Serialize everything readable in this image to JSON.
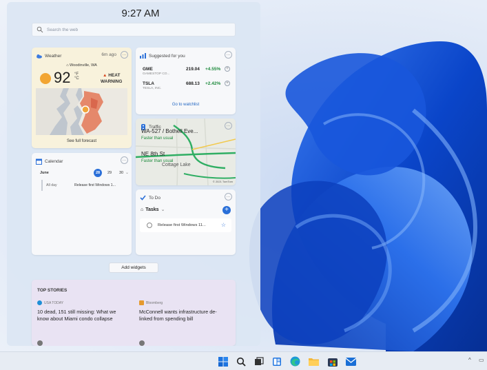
{
  "clock": "9:27 AM",
  "search": {
    "placeholder": "Search the web"
  },
  "weather": {
    "title": "Weather",
    "time": "6m ago",
    "location": "Woodinville, WA",
    "temp": "92",
    "unit_f": "°F",
    "unit_c": "°C",
    "warning_line1": "HEAT",
    "warning_line2": "WARNING",
    "link": "See full forecast"
  },
  "stocks": {
    "title": "Suggested for you",
    "items": [
      {
        "symbol": "GME",
        "name": "GAMESTOP CO...",
        "price": "219.04",
        "change": "+4.55%"
      },
      {
        "symbol": "TSLA",
        "name": "TESLA, INC.",
        "price": "688.13",
        "change": "+2.42%"
      }
    ],
    "link": "Go to watchlist"
  },
  "traffic": {
    "title": "Traffic",
    "route1": "WA-527 / Bothell Eve...",
    "route1_status": "Faster than usual",
    "route2": "NE 8th St",
    "route2_status": "Faster than usual",
    "place": "Cottage Lake",
    "copyright": "© 2021 TomTom"
  },
  "calendar": {
    "title": "Calendar",
    "month": "June",
    "days": [
      "28",
      "29",
      "30"
    ],
    "event_time": "All day",
    "event_title": "Release first Windows 1..."
  },
  "todo": {
    "title": "To Do",
    "list": "Tasks",
    "item": "Release first Windows 11..."
  },
  "add_widgets": "Add widgets",
  "stories": {
    "header": "TOP STORIES",
    "items": [
      {
        "source": "USA TODAY",
        "headline": "10 dead, 151 still missing: What we know about Miami condo collapse"
      },
      {
        "source": "Bloomberg",
        "headline": "McConnell wants infrastructure de-linked from spending bill"
      }
    ]
  },
  "colors": {
    "accent": "#2a6fd8",
    "positive": "#1d8a3c",
    "heat": "#d6451e"
  },
  "taskbar": {
    "icons": [
      "start-icon",
      "search-icon",
      "task-view-icon",
      "widgets-icon",
      "edge-icon",
      "file-explorer-icon",
      "store-icon",
      "mail-icon"
    ]
  }
}
